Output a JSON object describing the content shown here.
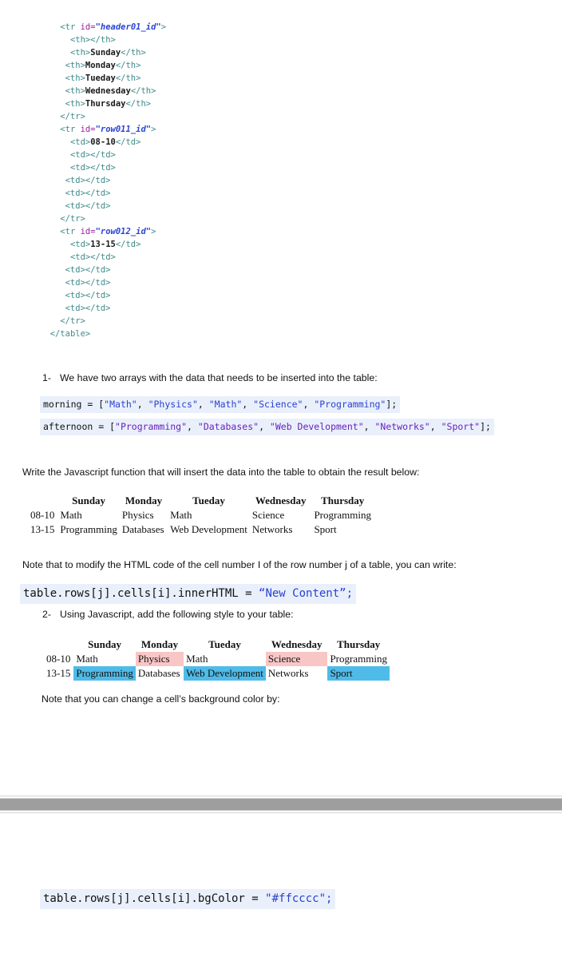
{
  "code_listing": {
    "name": "html-table-markup",
    "lines": [
      {
        "indent": 4,
        "parts": [
          {
            "t": "<tr ",
            "c": "tag"
          },
          {
            "t": "id=",
            "c": "attr"
          },
          {
            "t": "\"header01_id\"",
            "c": "attrval"
          },
          {
            "t": ">",
            "c": "tag"
          }
        ]
      },
      {
        "indent": 6,
        "parts": [
          {
            "t": "<th></th>",
            "c": "tag"
          }
        ]
      },
      {
        "indent": 6,
        "parts": [
          {
            "t": "<th>",
            "c": "tag"
          },
          {
            "t": "Sunday",
            "c": "txt"
          },
          {
            "t": "</th>",
            "c": "tag"
          }
        ]
      },
      {
        "indent": 5,
        "parts": [
          {
            "t": "<th>",
            "c": "tag"
          },
          {
            "t": "Monday",
            "c": "txt"
          },
          {
            "t": "</th>",
            "c": "tag"
          }
        ]
      },
      {
        "indent": 5,
        "parts": [
          {
            "t": "<th>",
            "c": "tag"
          },
          {
            "t": "Tueday",
            "c": "txt"
          },
          {
            "t": "</th>",
            "c": "tag"
          }
        ]
      },
      {
        "indent": 5,
        "parts": [
          {
            "t": "<th>",
            "c": "tag"
          },
          {
            "t": "Wednesday",
            "c": "txt"
          },
          {
            "t": "</th>",
            "c": "tag"
          }
        ]
      },
      {
        "indent": 5,
        "parts": [
          {
            "t": "<th>",
            "c": "tag"
          },
          {
            "t": "Thursday",
            "c": "txt"
          },
          {
            "t": "</th>",
            "c": "tag"
          }
        ]
      },
      {
        "indent": 4,
        "parts": [
          {
            "t": "</tr>",
            "c": "tag"
          }
        ]
      },
      {
        "indent": 4,
        "parts": [
          {
            "t": "<tr ",
            "c": "tag"
          },
          {
            "t": "id=",
            "c": "attr"
          },
          {
            "t": "\"row011_id\"",
            "c": "attrval"
          },
          {
            "t": ">",
            "c": "tag"
          }
        ]
      },
      {
        "indent": 6,
        "parts": [
          {
            "t": "<td>",
            "c": "tag"
          },
          {
            "t": "08-10",
            "c": "txt"
          },
          {
            "t": "</td>",
            "c": "tag"
          }
        ]
      },
      {
        "indent": 6,
        "parts": [
          {
            "t": "<td></td>",
            "c": "tag"
          }
        ]
      },
      {
        "indent": 6,
        "parts": [
          {
            "t": "<td></td>",
            "c": "tag"
          }
        ]
      },
      {
        "indent": 5,
        "parts": [
          {
            "t": "<td></td>",
            "c": "tag"
          }
        ]
      },
      {
        "indent": 5,
        "parts": [
          {
            "t": "<td></td>",
            "c": "tag"
          }
        ]
      },
      {
        "indent": 5,
        "parts": [
          {
            "t": "<td></td>",
            "c": "tag"
          }
        ]
      },
      {
        "indent": 4,
        "parts": [
          {
            "t": "</tr>",
            "c": "tag"
          }
        ]
      },
      {
        "indent": 4,
        "parts": [
          {
            "t": "<tr ",
            "c": "tag"
          },
          {
            "t": "id=",
            "c": "attr"
          },
          {
            "t": "\"row012_id\"",
            "c": "attrval"
          },
          {
            "t": ">",
            "c": "tag"
          }
        ]
      },
      {
        "indent": 6,
        "parts": [
          {
            "t": "<td>",
            "c": "tag"
          },
          {
            "t": "13-15",
            "c": "txt"
          },
          {
            "t": "</td>",
            "c": "tag"
          }
        ]
      },
      {
        "indent": 6,
        "parts": [
          {
            "t": "<td></td>",
            "c": "tag"
          }
        ]
      },
      {
        "indent": 5,
        "parts": [
          {
            "t": "<td></td>",
            "c": "tag"
          }
        ]
      },
      {
        "indent": 5,
        "parts": [
          {
            "t": "<td></td>",
            "c": "tag"
          }
        ]
      },
      {
        "indent": 5,
        "parts": [
          {
            "t": "<td></td>",
            "c": "tag"
          }
        ]
      },
      {
        "indent": 5,
        "parts": [
          {
            "t": "<td></td>",
            "c": "tag"
          }
        ]
      },
      {
        "indent": 4,
        "parts": [
          {
            "t": "</tr>",
            "c": "tag"
          }
        ]
      },
      {
        "indent": 2,
        "parts": [
          {
            "t": "</table>",
            "c": "tag"
          }
        ]
      }
    ]
  },
  "item1": {
    "number": "1-",
    "text": "We have two arrays with the data that needs to be inserted into the table:"
  },
  "code_morning": {
    "prefix": "morning = [",
    "strings": [
      "\"Math\"",
      "\"Physics\"",
      "\"Math\"",
      "\"Science\"",
      "\"Programming\""
    ],
    "suffix": "];",
    "full": "morning = [\"Math\", \"Physics\", \"Math\", \"Science\", \"Programming\"];"
  },
  "code_afternoon": {
    "prefix": "afternoon = [",
    "strings": [
      "\"Programming\"",
      "\"Databases\"",
      "\"Web Development\"",
      "\"Networks\"",
      "\"Sport\""
    ],
    "suffix": "];",
    "full": "afternoon = [\"Programming\", \"Databases\", \"Web Development\", \"Networks\", \"Sport\"];"
  },
  "instruction_write": "Write the Javascript function that will insert the data into the table to obtain the result below:",
  "result_table_1": {
    "headers": [
      "",
      "Sunday",
      "Monday",
      "Tueday",
      "Wednesday",
      "Thursday"
    ],
    "rows": [
      {
        "time": "08-10",
        "cells": [
          {
            "text": "Math",
            "hl": "none"
          },
          {
            "text": "Physics",
            "hl": "none"
          },
          {
            "text": "Math",
            "hl": "none"
          },
          {
            "text": "Science",
            "hl": "none"
          },
          {
            "text": "Programming",
            "hl": "none"
          }
        ]
      },
      {
        "time": "13-15",
        "cells": [
          {
            "text": "Programming",
            "hl": "none"
          },
          {
            "text": "Databases",
            "hl": "none"
          },
          {
            "text": "Web Development",
            "hl": "none"
          },
          {
            "text": "Networks",
            "hl": "none"
          },
          {
            "text": "Sport",
            "hl": "none"
          }
        ]
      }
    ]
  },
  "note_modify": "Note that to modify the HTML code of the cell number I of the row number j of a table, you can write:",
  "code_innerhtml": {
    "pre": "table.rows[j].cells[i].innerHTML = ",
    "str": "“New Content”;",
    "full": "table.rows[j].cells[i].innerHTML = “New Content”;"
  },
  "item2": {
    "number": "2-",
    "text": "Using Javascript, add the following style to your table:"
  },
  "result_table_2": {
    "headers": [
      "",
      "Sunday",
      "Monday",
      "Tueday",
      "Wednesday",
      "Thursday"
    ],
    "rows": [
      {
        "time": "08-10",
        "cells": [
          {
            "text": "Math",
            "hl": "none"
          },
          {
            "text": "Physics",
            "hl": "pink"
          },
          {
            "text": "Math",
            "hl": "none"
          },
          {
            "text": "Science",
            "hl": "pink"
          },
          {
            "text": "Programming",
            "hl": "none"
          }
        ]
      },
      {
        "time": "13-15",
        "cells": [
          {
            "text": "Programming",
            "hl": "blue"
          },
          {
            "text": "Databases",
            "hl": "none"
          },
          {
            "text": "Web Development",
            "hl": "blue"
          },
          {
            "text": "Networks",
            "hl": "none"
          },
          {
            "text": "Sport",
            "hl": "blue"
          }
        ]
      }
    ]
  },
  "note_bgcolor": "Note that you can change a cell’s background color by:",
  "code_bgcolor": {
    "pre": "table.rows[j].cells[i].bgColor = ",
    "str": "\"#ffcccc\";",
    "full": "table.rows[j].cells[i].bgColor = \"#ffcccc\";"
  },
  "colors": {
    "highlight_pink": "#ffcccc",
    "highlight_blue": "#4fbbe8",
    "code_background": "#e9f0fb",
    "page_break_bar": "#9e9e9e",
    "string_blue": "#2b3fd0",
    "attr_purple": "#9b1fa0",
    "tag_teal": "#3f8a8a"
  }
}
